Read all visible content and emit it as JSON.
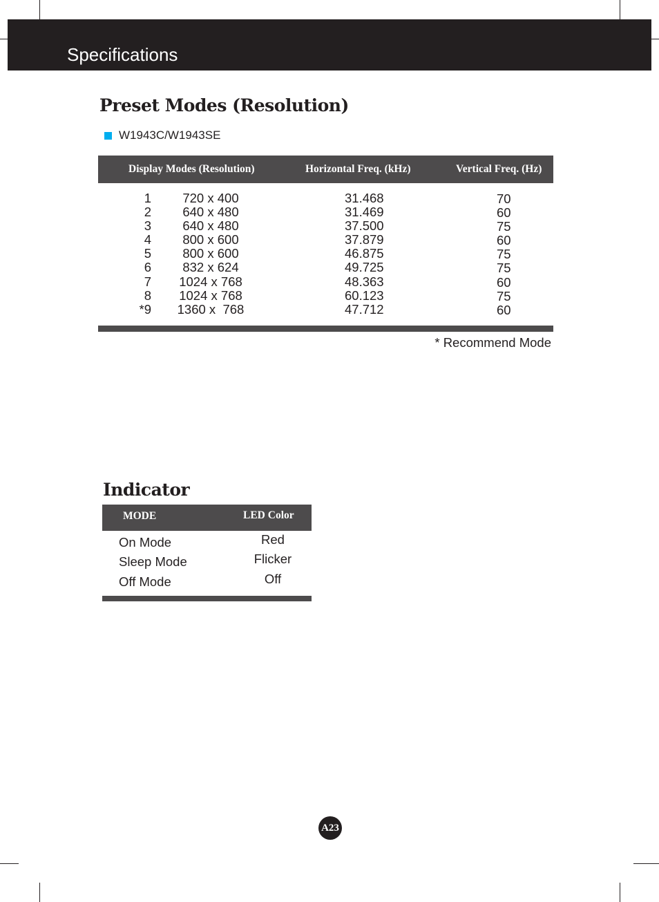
{
  "header": {
    "title": "Specifications"
  },
  "preset_modes": {
    "title": "Preset Modes (Resolution)",
    "model": "W1943C/W1943SE",
    "bullet_color": "#00aeef",
    "columns": {
      "display_modes": "Display Modes (Resolution)",
      "horizontal_freq": "Horizontal Freq. (kHz)",
      "vertical_freq": "Vertical Freq. (Hz)"
    },
    "rows": [
      {
        "no": "1",
        "resolution": "720 x 400",
        "h_freq": "31.468",
        "v_freq": "70"
      },
      {
        "no": "2",
        "resolution": "640 x 480",
        "h_freq": "31.469",
        "v_freq": "60"
      },
      {
        "no": "3",
        "resolution": "640 x 480",
        "h_freq": "37.500",
        "v_freq": "75"
      },
      {
        "no": "4",
        "resolution": "800 x 600",
        "h_freq": "37.879",
        "v_freq": "60"
      },
      {
        "no": "5",
        "resolution": "800 x 600",
        "h_freq": "46.875",
        "v_freq": "75"
      },
      {
        "no": "6",
        "resolution": "832 x 624",
        "h_freq": "49.725",
        "v_freq": "75"
      },
      {
        "no": "7",
        "resolution": "1024 x 768",
        "h_freq": "48.363",
        "v_freq": "60"
      },
      {
        "no": "8",
        "resolution": "1024 x 768",
        "h_freq": "60.123",
        "v_freq": "75"
      },
      {
        "no": "*9",
        "resolution": "1360 x  768",
        "h_freq": "47.712",
        "v_freq": "60"
      }
    ],
    "note": "* Recommend Mode"
  },
  "indicator": {
    "title": "Indicator",
    "columns": {
      "mode": "MODE",
      "led_color": "LED Color"
    },
    "rows": [
      {
        "mode": "On Mode",
        "led": "Red"
      },
      {
        "mode": "Sleep Mode",
        "led": "Flicker"
      },
      {
        "mode": "Off Mode",
        "led": "Off"
      }
    ]
  },
  "page_number": "A23"
}
